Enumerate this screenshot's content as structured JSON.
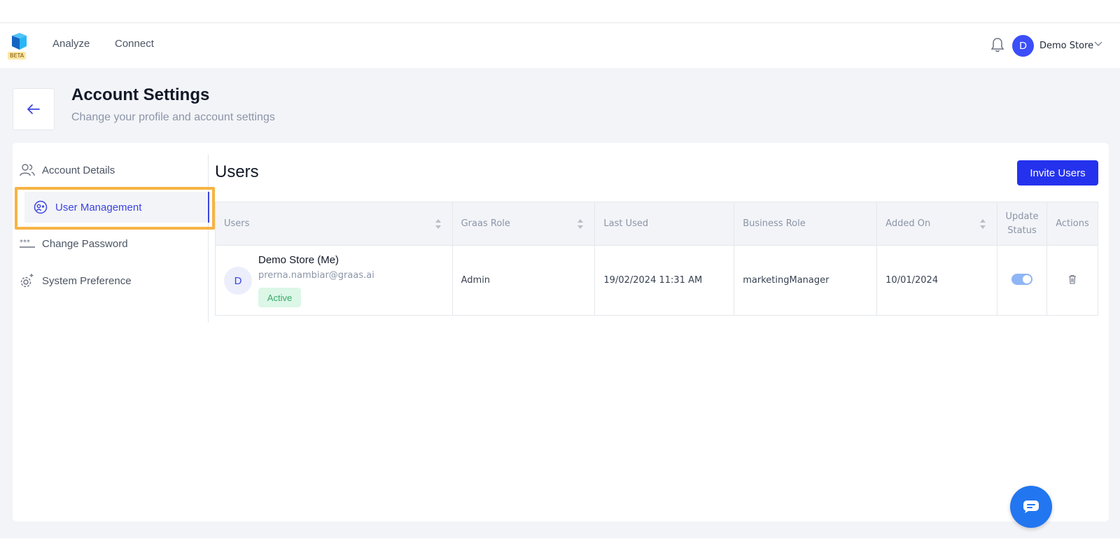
{
  "header": {
    "beta_label": "BETA",
    "nav": [
      "Analyze",
      "Connect"
    ],
    "user": {
      "avatar_letter": "D",
      "name": "Demo Store"
    }
  },
  "page": {
    "title": "Account Settings",
    "subtitle": "Change your profile and account settings"
  },
  "sidebar": {
    "items": [
      {
        "label": "Account Details",
        "icon": "users-icon"
      },
      {
        "label": "User Management",
        "icon": "user-management-icon",
        "active": true
      },
      {
        "label": "Change Password",
        "icon": "password-icon"
      },
      {
        "label": "System Preference",
        "icon": "settings-gear-icon"
      }
    ]
  },
  "users_section": {
    "title": "Users",
    "invite_label": "Invite Users",
    "columns": [
      "Users",
      "Graas Role",
      "Last Used",
      "Business Role",
      "Added On",
      "Update Status",
      "Actions"
    ],
    "rows": [
      {
        "avatar_letter": "D",
        "name": "Demo Store (Me)",
        "email": "prerna.nambiar@graas.ai",
        "status": "Active",
        "graas_role": "Admin",
        "last_used": "19/02/2024 11:31 AM",
        "business_role": "marketingManager",
        "added_on": "10/01/2024",
        "update_status": true
      }
    ]
  },
  "colors": {
    "accent": "#2432ee",
    "highlight": "#f6b445",
    "active_badge_bg": "#dcf7e7",
    "active_badge_text": "#3aa86b"
  }
}
